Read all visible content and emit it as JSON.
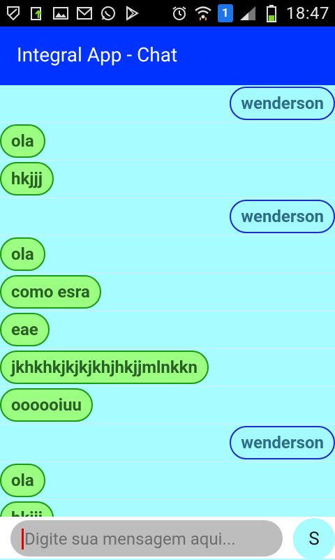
{
  "status_bar": {
    "time": "18:47",
    "notification_badge": "1",
    "icons": [
      "shield-icon",
      "upload-icon",
      "image-icon",
      "mail-icon",
      "whatsapp-icon",
      "play-store-icon",
      "alarm-icon",
      "wifi-icon",
      "signal-icon",
      "battery-icon"
    ]
  },
  "app_bar": {
    "title": "Integral App - Chat"
  },
  "messages": [
    {
      "text": "wenderson",
      "side": "me"
    },
    {
      "text": "ola",
      "side": "them"
    },
    {
      "text": "hkjjj",
      "side": "them"
    },
    {
      "text": "wenderson",
      "side": "me"
    },
    {
      "text": "ola",
      "side": "them"
    },
    {
      "text": "como esra",
      "side": "them"
    },
    {
      "text": "eae",
      "side": "them"
    },
    {
      "text": "jkhkhkjkjkjkhjhkjjmlnkkn",
      "side": "them"
    },
    {
      "text": "oooooiuu",
      "side": "them"
    },
    {
      "text": "wenderson",
      "side": "me"
    },
    {
      "text": "ola",
      "side": "them"
    },
    {
      "text": "hkjjj",
      "side": "them"
    }
  ],
  "composer": {
    "placeholder": "Digite sua mensagem aqui...",
    "send_label": "S"
  },
  "colors": {
    "app_bar": "#0033ff",
    "chat_background": "#a6fcff",
    "bubble_them": "#9bff82",
    "bubble_me": "#a4fbff"
  }
}
